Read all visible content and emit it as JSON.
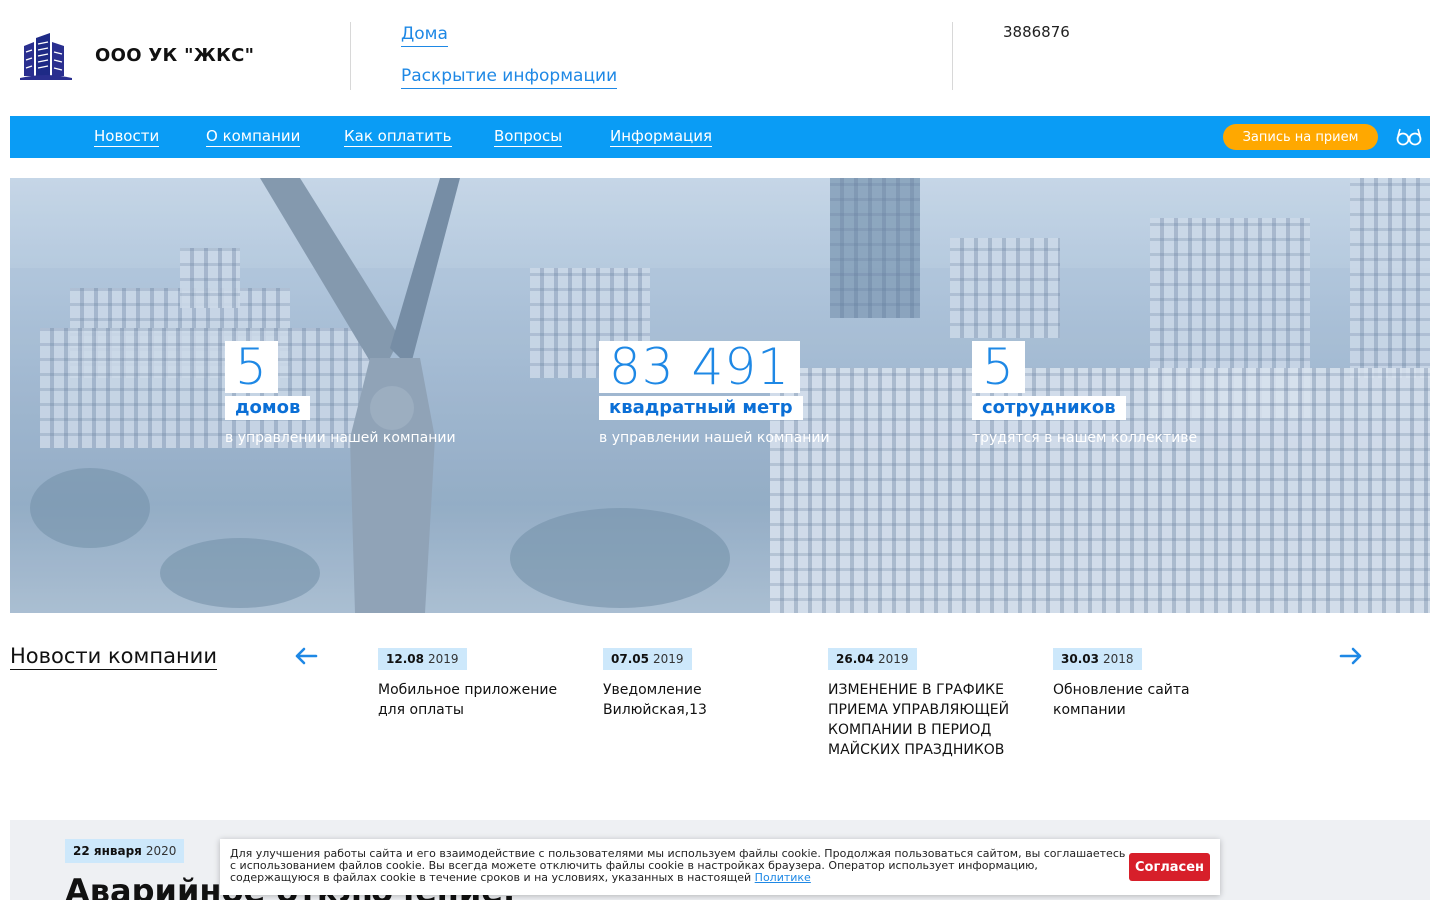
{
  "header": {
    "company_name": "ООО УК \"ЖКС\"",
    "links": [
      "Дома",
      "Раскрытие информации"
    ],
    "phone": "3886876"
  },
  "nav": {
    "items": [
      "Новости",
      "О компании",
      "Как оплатить",
      "Вопросы",
      "Информация"
    ],
    "appointment_label": "Запись на прием"
  },
  "hero": {
    "stats": [
      {
        "number": "5",
        "unit": "домов",
        "desc": "в управлении нашей компании"
      },
      {
        "number": "83 491",
        "unit": "квадратный метр",
        "desc": "в управлении нашей компании"
      },
      {
        "number": "5",
        "unit": "сотрудников",
        "desc": "трудятся в нашем коллективе"
      }
    ]
  },
  "news": {
    "title": "Новости компании",
    "items": [
      {
        "day": "12.08",
        "year": "2019",
        "text": "Мобильное приложение для оплаты"
      },
      {
        "day": "07.05",
        "year": "2019",
        "text": "Уведомление Вилюйская,13"
      },
      {
        "day": "26.04",
        "year": "2019",
        "text": "ИЗМЕНЕНИЕ В ГРАФИКЕ ПРИЕМА УПРАВЛЯЮЩЕЙ КОМПАНИИ В ПЕРИОД МАЙСКИХ ПРАЗДНИКОВ"
      },
      {
        "day": "30.03",
        "year": "2018",
        "text": "Обновление сайта компании"
      }
    ]
  },
  "featured": {
    "day": "22 января",
    "year": "2020",
    "headline": "Аварийное отключение."
  },
  "cookie": {
    "text": "Для улучшения работы сайта и его взаимодействие с пользователями мы используем файлы cookie. Продолжая пользоваться сайтом, вы соглашаетесь с использованием файлов cookie. Вы всегда можете отключить файлы cookie в настройках браузера. Оператор использует информацию, содержащуюся в файлах cookie в течение сроков и на условиях, указанных в настоящей",
    "policy_link": "Политике",
    "agree_label": "Согласен"
  },
  "colors": {
    "accent": "#0a9cf5",
    "link": "#1e88e5",
    "button_orange": "#ffa800",
    "button_red": "#d71f2a"
  }
}
